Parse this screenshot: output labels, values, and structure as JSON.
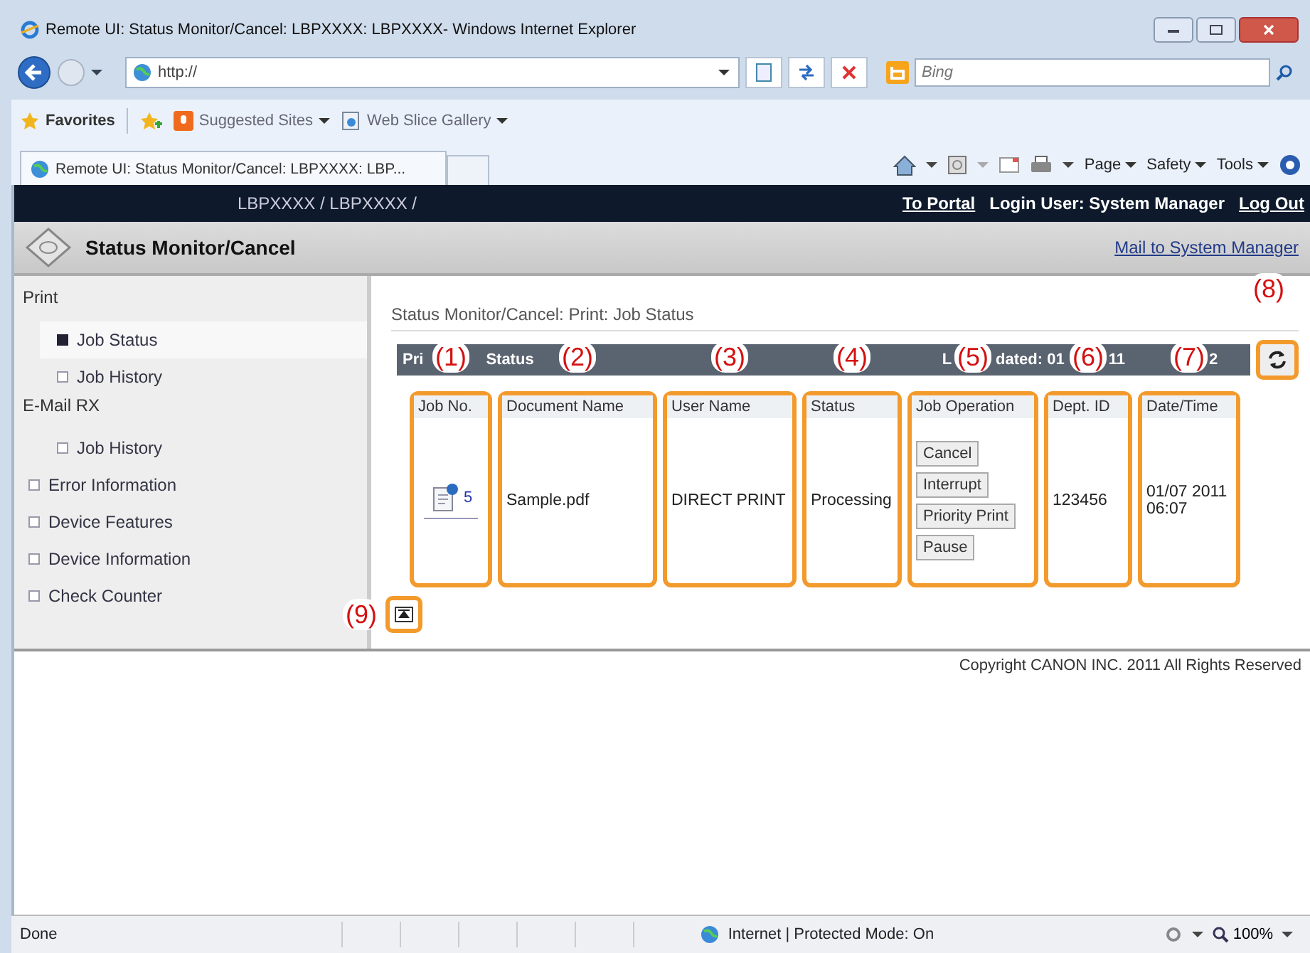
{
  "window": {
    "title": "Remote UI: Status Monitor/Cancel: LBPXXXX: LBPXXXX- Windows Internet Explorer"
  },
  "address_bar": {
    "value": "http://"
  },
  "search": {
    "placeholder": "Bing"
  },
  "favorites_bar": {
    "favorites": "Favorites",
    "items": [
      "Suggested Sites",
      "Web Slice Gallery"
    ]
  },
  "tab": {
    "title": "Remote UI: Status Monitor/Cancel: LBPXXXX: LBP..."
  },
  "command_bar": [
    "Page",
    "Safety",
    "Tools"
  ],
  "page": {
    "device": "LBPXXXX / LBPXXXX /",
    "header_items": [
      {
        "kind": "link",
        "text": "To Portal"
      },
      {
        "kind": "text",
        "text": "Login User: System Manager"
      },
      {
        "kind": "link",
        "text": "Log Out"
      }
    ],
    "title": "Status Monitor/Cancel",
    "mail_link": "Mail to System Manager",
    "sidebar": [
      {
        "kind": "heading",
        "label": "Print"
      },
      {
        "kind": "sub",
        "label": "Job Status",
        "selected": true
      },
      {
        "kind": "sub",
        "label": "Job History",
        "selected": false
      },
      {
        "kind": "heading",
        "label": "E-Mail RX"
      },
      {
        "kind": "sub",
        "label": "Job History",
        "selected": false
      },
      {
        "kind": "item",
        "label": "Error Information",
        "selected": false
      },
      {
        "kind": "item",
        "label": "Device Features",
        "selected": false
      },
      {
        "kind": "item",
        "label": "Device Information",
        "selected": false
      },
      {
        "kind": "item",
        "label": "Check Counter",
        "selected": false
      }
    ],
    "breadcrumb": "Status Monitor/Cancel: Print: Job Status",
    "bar_fragments": [
      "Pri",
      "Status",
      "L",
      "dated: 01",
      "11",
      "2"
    ],
    "refresh_callout": "(8)",
    "columns": [
      {
        "heading": "Job No.",
        "callout": "(1)",
        "kind": "job",
        "value": "5"
      },
      {
        "heading": "Document Name",
        "callout": "(2)",
        "kind": "text",
        "value": "Sample.pdf"
      },
      {
        "heading": "User Name",
        "callout": "(3)",
        "kind": "text",
        "value": "DIRECT PRINT"
      },
      {
        "heading": "Status",
        "callout": "(4)",
        "kind": "text",
        "value": "Processing"
      },
      {
        "heading": "Job Operation",
        "callout": "(5)",
        "kind": "buttons",
        "buttons": [
          "Cancel",
          "Interrupt",
          "Priority Print",
          "Pause"
        ]
      },
      {
        "heading": "Dept. ID",
        "callout": "(6)",
        "kind": "text",
        "value": "123456"
      },
      {
        "heading": "Date/Time",
        "callout": "(7)",
        "kind": "text",
        "value": "01/07 2011 06:07"
      }
    ],
    "top_callout": "(9)",
    "copyright": "Copyright CANON INC. 2011 All Rights Reserved"
  },
  "status_bar": {
    "status": "Done",
    "zone": "Internet | Protected Mode: On",
    "zoom": "100%"
  }
}
